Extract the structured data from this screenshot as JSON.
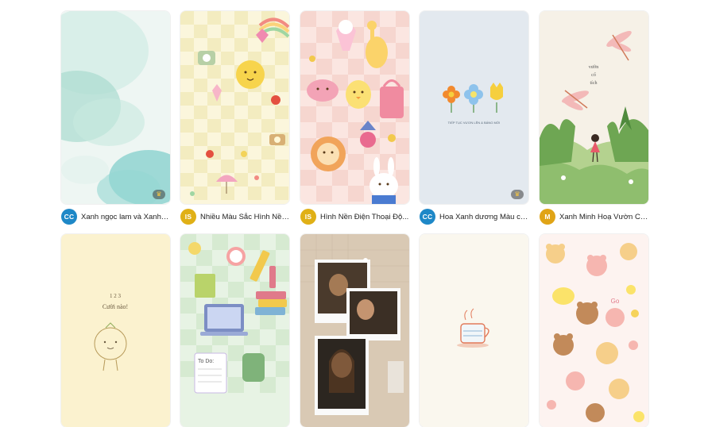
{
  "templates": [
    {
      "title": "Xanh ngọc lam và Xanh l...",
      "avatar_text": "CC",
      "avatar_color": "#1e88c7",
      "premium": true,
      "thumb": "aqua-watercolor"
    },
    {
      "title": "Nhiều Màu Sắc Hình Nền...",
      "avatar_text": "IS",
      "avatar_color": "#e0b016",
      "premium": false,
      "thumb": "cute-pattern-yellow"
    },
    {
      "title": "Hình Nền Điện Thoại Độ...",
      "avatar_text": "IS",
      "avatar_color": "#e0b016",
      "premium": false,
      "thumb": "cute-animals-pink"
    },
    {
      "title": "Hoa Xanh dương Màu ca...",
      "avatar_text": "CC",
      "avatar_color": "#1e88c7",
      "premium": true,
      "thumb": "flowers-blue",
      "thumb_text": "TIẾP TỤC VƯƠN LÊN & BÁNG MỚI"
    },
    {
      "title": "Xanh Minh Hoạ Vườn Cổ ...",
      "avatar_text": "M",
      "avatar_color": "#e0a416",
      "premium": false,
      "thumb": "garden-green",
      "thumb_text_1": "vườn",
      "thumb_text_2": "cổ",
      "thumb_text_3": "tích"
    },
    {
      "thumb": "smile-orange",
      "thumb_text_1": "1 2 3",
      "thumb_text_2": "Cười nào!"
    },
    {
      "thumb": "study-pattern",
      "thumb_text": "To Do:"
    },
    {
      "thumb": "photo-collage"
    },
    {
      "thumb": "coffee-cup"
    },
    {
      "thumb": "bears-pattern",
      "thumb_text": "Go"
    }
  ],
  "colors": {
    "page_bg": "#ffffff",
    "text": "#222222",
    "premium_badge": "#f5c542"
  }
}
